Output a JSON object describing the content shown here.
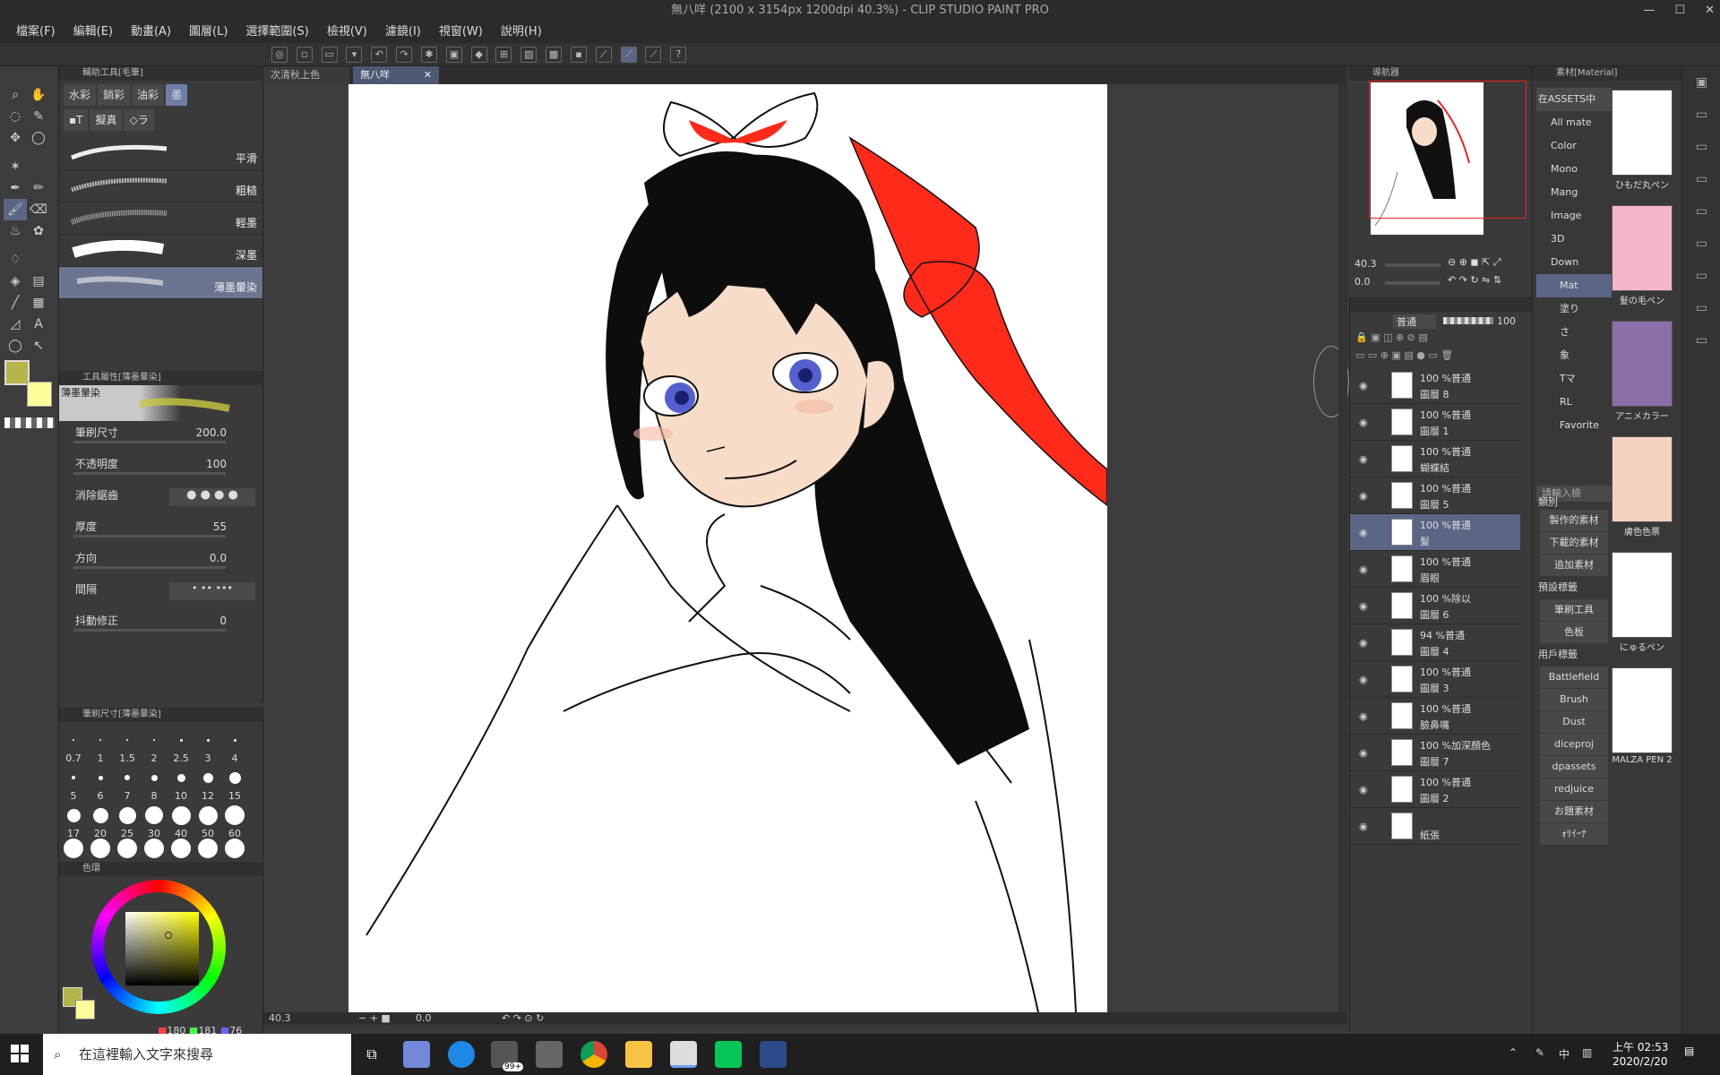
{
  "window": {
    "title": "無八咩 (2100 x 3154px 1200dpi 40.3%) - CLIP STUDIO PAINT PRO",
    "min": "—",
    "max": "☐",
    "close": "✕"
  },
  "menu": [
    "檔案(F)",
    "編輯(E)",
    "動畫(A)",
    "圖層(L)",
    "選擇範圍(S)",
    "檢視(V)",
    "濾鏡(I)",
    "視窗(W)",
    "說明(H)"
  ],
  "subtool": {
    "title": "輔助工具[毛筆]",
    "tabs": [
      "水彩",
      "銷彩",
      "油彩",
      "墨",
      "▪T",
      "擬真",
      "◇ラ"
    ],
    "brushes": [
      "平滑",
      "粗糙",
      "輕墨",
      "深墨",
      "薄墨暈染"
    ]
  },
  "toolprop": {
    "title": "工具屬性[薄墨暈染]",
    "brush_name": "薄墨暈染",
    "rows": [
      {
        "label": "筆刷尺寸",
        "value": "200.0"
      },
      {
        "label": "不透明度",
        "value": "100"
      },
      {
        "label": "消除鋸齒",
        "value": ""
      },
      {
        "label": "厚度",
        "value": "55"
      },
      {
        "label": "方向",
        "value": "0.0"
      },
      {
        "label": "間隔",
        "value": ""
      },
      {
        "label": "抖動修正",
        "value": "0"
      }
    ]
  },
  "brushsize": {
    "title": "筆刷尺寸[薄墨暈染]",
    "sizes": [
      "0.7",
      "1",
      "1.5",
      "2",
      "2.5",
      "3",
      "4",
      "5",
      "6",
      "7",
      "8",
      "10",
      "12",
      "15",
      "17",
      "20",
      "25",
      "30",
      "40",
      "50",
      "60"
    ]
  },
  "color": {
    "title": "色環",
    "r": "180",
    "g": "181",
    "b": "76",
    "main": "#b5b54c",
    "sub": "#fdfd9b"
  },
  "doc_tabs": [
    "次清秋上色",
    "無八咩"
  ],
  "status": {
    "zoom": "40.3",
    "angle": "0.0"
  },
  "navigator": {
    "title": "導航器",
    "zoom": "40.3",
    "angle": "0.0"
  },
  "layers": {
    "blend": "普通",
    "opacity": "100",
    "items": [
      {
        "mode": "100 %普通",
        "name": "圖層 8"
      },
      {
        "mode": "100 %普通",
        "name": "圖層 1"
      },
      {
        "mode": "100 %普通",
        "name": "蝴蝶結"
      },
      {
        "mode": "100 %普通",
        "name": "圖層 5"
      },
      {
        "mode": "100 %普通",
        "name": "髮"
      },
      {
        "mode": "100 %普通",
        "name": "眉眼"
      },
      {
        "mode": "100 %除以",
        "name": "圖層 6"
      },
      {
        "mode": "94 %普通",
        "name": "圖層 4"
      },
      {
        "mode": "100 %普通",
        "name": "圖層 3"
      },
      {
        "mode": "100 %普通",
        "name": "臉鼻嘴"
      },
      {
        "mode": "100 %加深顏色",
        "name": "圖層 7"
      },
      {
        "mode": "100 %普通",
        "name": "圖層 2"
      },
      {
        "mode": "",
        "name": "紙張"
      }
    ]
  },
  "material": {
    "title": "素材[Material]",
    "tree": [
      "在ASSETS中",
      "All mate",
      "Color",
      "Mono",
      "Mang",
      "Image",
      "3D",
      "Down",
      "Mat",
      "塗り",
      "さ",
      "象",
      "Tマ",
      "RL",
      "Favorite"
    ],
    "search": "請輸入檢",
    "cat": "類別",
    "tags": [
      "製作的素材",
      "下載的素材",
      "追加素材",
      "預設標籤",
      "筆刷工具",
      "色板",
      "用戶標籤",
      "Battlefield",
      "Brush",
      "Dust",
      "diceproj",
      "dpassets",
      "redjuice",
      "お題素材",
      "ｫﾘｲｰﾅ"
    ],
    "items": [
      "ひもだ丸ペン",
      "髮の毛ペン",
      "アニメカラー",
      "膚色色票",
      "にゅるペン",
      "MALZA PEN 2"
    ]
  },
  "taskbar": {
    "search": "在這裡輸入文字來搜尋",
    "time": "上午 02:53",
    "date": "2020/2/20",
    "ime": "中",
    "badge": "99+"
  }
}
